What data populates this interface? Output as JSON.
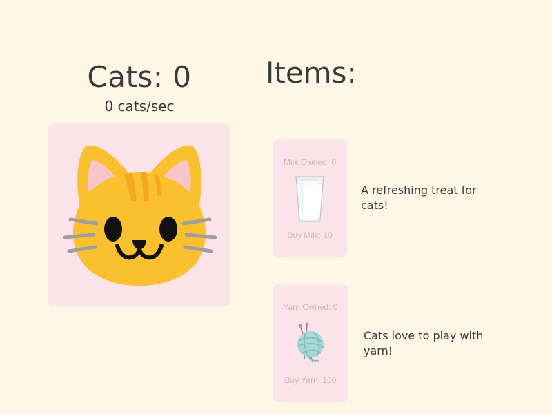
{
  "game": {
    "cats_label": "Cats: 0",
    "rate_label": "0 cats/sec"
  },
  "shop": {
    "title": "Items:",
    "items": [
      {
        "owned_label": "Milk Owned: 0",
        "buy_label": "Buy Milk: 10",
        "description": "A refreshing treat for cats!",
        "icon": "milk-glass-icon"
      },
      {
        "owned_label": "Yarn Owned: 0",
        "buy_label": "Buy Yarn: 100",
        "description": "Cats love to play with yarn!",
        "icon": "yarn-ball-icon"
      }
    ]
  },
  "colors": {
    "background": "#fff7e6",
    "card": "#fae3e9",
    "cat_face": "#fbc02d",
    "cat_stripe": "#f5a623",
    "text": "#3a3a3a",
    "muted_text": "#cdb8bd"
  }
}
